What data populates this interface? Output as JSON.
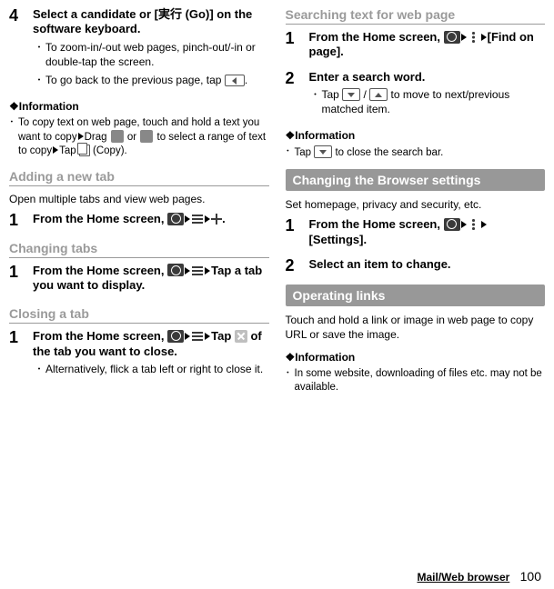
{
  "left": {
    "step4": {
      "num": "4",
      "title": "Select a candidate or [実行 (Go)] on the software keyboard.",
      "b1": "To zoom-in/-out web pages, pinch-out/-in or double-tap the screen.",
      "b2a": "To go back to the previous page, tap ",
      "b2b": "."
    },
    "info1": {
      "heading": "❖Information",
      "a": "To copy text on web page, touch and hold a text you want to copy",
      "b": "Drag ",
      "c": " or ",
      "d": " to select a range of text to copy",
      "e": "Tap ",
      "f": " (Copy)."
    },
    "addtab": {
      "heading": "Adding a new tab",
      "txt": "Open multiple tabs and view web pages.",
      "num": "1",
      "t1": "From the Home screen, ",
      "t2": "."
    },
    "chtab": {
      "heading": "Changing tabs",
      "num": "1",
      "t1": "From the Home screen, ",
      "t2": "Tap a tab you want to display."
    },
    "cltab": {
      "heading": "Closing a tab",
      "num": "1",
      "t1": "From the Home screen, ",
      "t2": "Tap ",
      "t3": " of the tab you want to close.",
      "b1": "Alternatively, flick a tab left or right to close it."
    }
  },
  "right": {
    "search": {
      "heading": "Searching text for web page",
      "s1num": "1",
      "s1a": "From the Home screen, ",
      "s1b": "[Find on page].",
      "s2num": "2",
      "s2title": "Enter a search word.",
      "s2a": "Tap ",
      "s2b": " / ",
      "s2c": " to move to next/previous matched item.",
      "info_h": "❖Information",
      "info_a": "Tap ",
      "info_b": " to close the search bar."
    },
    "settings": {
      "banner": "Changing the Browser settings",
      "txt": "Set homepage, privacy and security, etc.",
      "s1num": "1",
      "s1a": "From the Home screen, ",
      "s1b": "[Settings].",
      "s2num": "2",
      "s2title": "Select an item to change."
    },
    "links": {
      "banner": "Operating links",
      "txt": "Touch and hold a link or image in web page to copy URL or save the image.",
      "info_h": "❖Information",
      "info_a": "In some website, downloading of files etc. may not be available."
    }
  },
  "footer": {
    "section": "Mail/Web browser",
    "page": "100"
  }
}
